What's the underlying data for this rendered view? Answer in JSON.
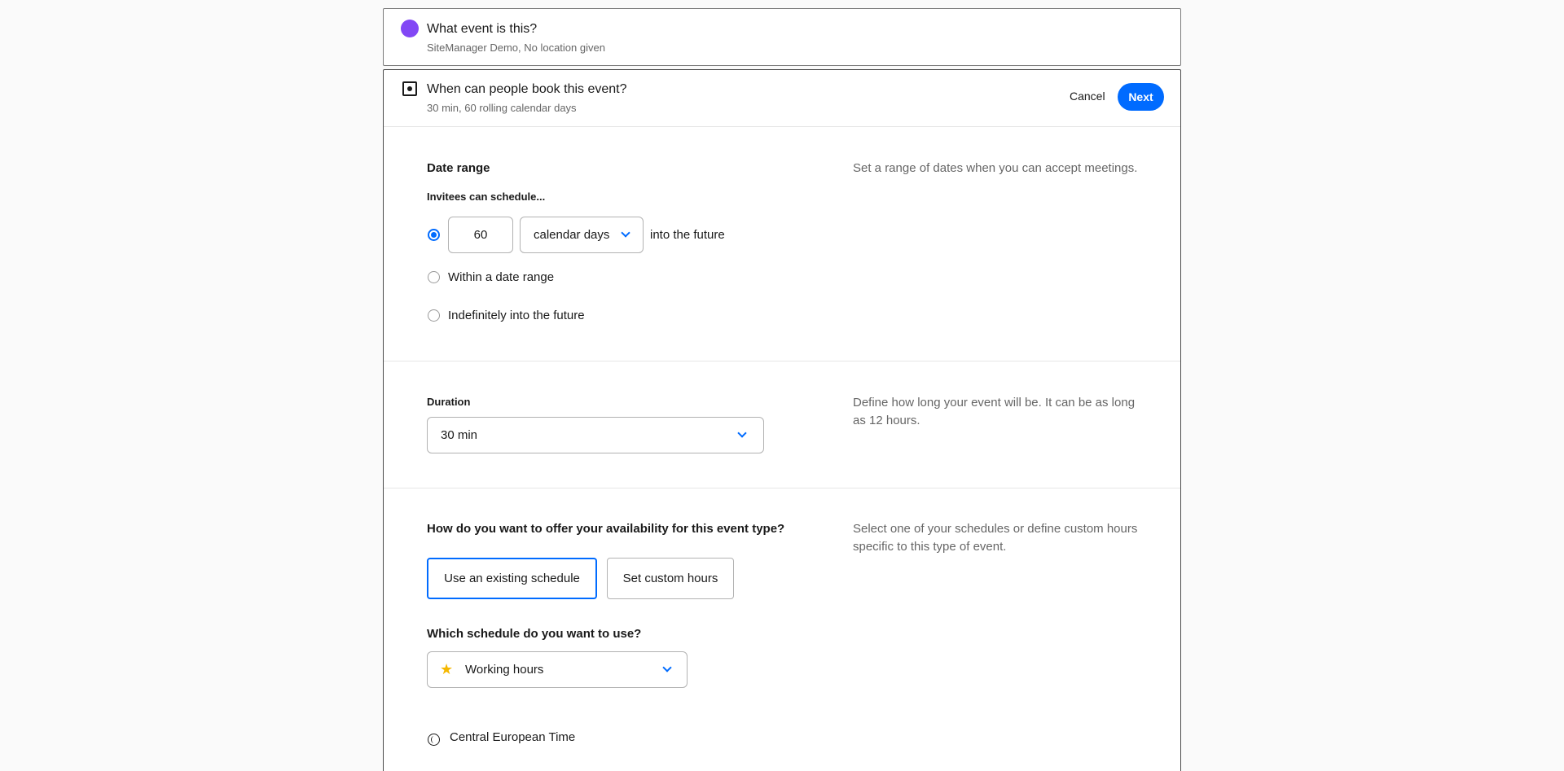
{
  "event_card": {
    "title": "What event is this?",
    "subtitle": "SiteManager Demo, No location given",
    "color": "#8247f5"
  },
  "booking_card": {
    "title": "When can people book this event?",
    "subtitle": "30 min, 60 rolling calendar days",
    "cancel_label": "Cancel",
    "next_label": "Next",
    "accent": "#006bff"
  },
  "date_range": {
    "heading": "Date range",
    "subheading": "Invitees can schedule...",
    "help": "Set a range of dates when you can accept meetings.",
    "days_value": "60",
    "unit_selected": "calendar days",
    "into_future_label": "into the future",
    "options": [
      {
        "label": "Within a date range",
        "selected": false
      },
      {
        "label": "Indefinitely into the future",
        "selected": false
      }
    ],
    "rolling_selected": true
  },
  "duration": {
    "heading": "Duration",
    "help": "Define how long your event will be. It can be as long as 12 hours.",
    "selected": "30 min"
  },
  "availability": {
    "heading": "How do you want to offer your availability for this event type?",
    "help": "Select one of your schedules or define custom hours specific to this type of event.",
    "existing_label": "Use an existing schedule",
    "custom_label": "Set custom hours",
    "which_label": "Which schedule do you want to use?",
    "schedule_selected": "Working hours",
    "schedule_icon": "star-icon",
    "timezone": "Central European Time"
  }
}
